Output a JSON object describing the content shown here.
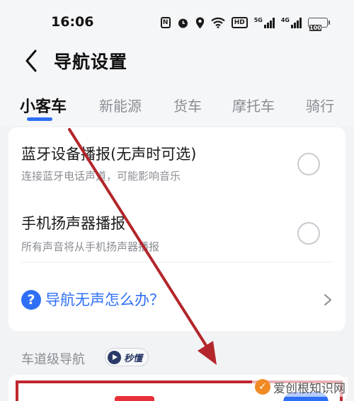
{
  "status_bar": {
    "time": "16:06",
    "nfc_label": "N",
    "hd_label": "HD",
    "sim1_label": "5G",
    "sim2_label": "4G",
    "battery": "100"
  },
  "header": {
    "title": "导航设置"
  },
  "tabs": [
    {
      "label": "小客车",
      "active": true
    },
    {
      "label": "新能源",
      "active": false
    },
    {
      "label": "货车",
      "active": false
    },
    {
      "label": "摩托车",
      "active": false
    },
    {
      "label": "骑行",
      "active": false
    }
  ],
  "settings": {
    "bluetooth": {
      "title": "蓝牙设备播报(无声时可选)",
      "subtitle": "连接蓝牙电话声道，可能影响音乐",
      "checked": false
    },
    "speaker": {
      "title": "手机扬声器播报",
      "subtitle": "所有声音将从手机扬声器播报",
      "checked": false
    },
    "help": {
      "text": "导航无声怎么办？"
    }
  },
  "lane_section": {
    "label": "车道级导航",
    "badge": "秒懂"
  },
  "watermark": {
    "text": "爱创根知识网"
  },
  "colors": {
    "accent": "#2f6ff6",
    "annotation_red": "#c0262e",
    "background": "#f2f3f5"
  }
}
